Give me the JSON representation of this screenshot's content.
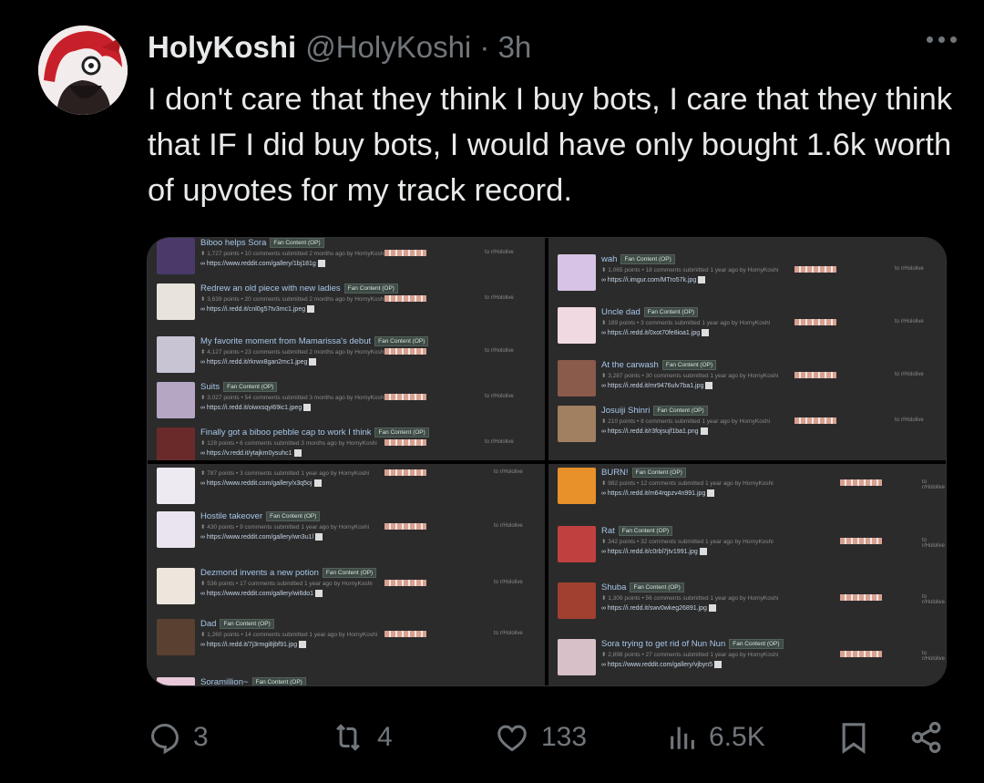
{
  "author": {
    "display_name": "HolyKoshi",
    "handle": "@HolyKoshi · 3h"
  },
  "tweet": {
    "text": "I don't care that they think I buy bots, I care that they think that IF I did buy bots, I would have only bought 1.6k worth of upvotes for my track record."
  },
  "media": {
    "flair": "Fan Content (OP)",
    "subreddit": "to r/Hololive",
    "panels": [
      {
        "entries": [
          {
            "title": "Biboo helps Sora",
            "meta": "1,727 points • 10 comments submitted 2 months ago by HornyKoshi",
            "url": "https://www.reddit.com/gallery/1bj181g",
            "thumb": "#4a3a6a"
          },
          {
            "title": "Redrew an old piece with new ladies",
            "meta": "3,639 points • 20 comments submitted 2 months ago by HornyKoshi",
            "url": "https://i.redd.it/cnl0g57tv3mc1.jpeg",
            "thumb": "#e8e4dc"
          },
          {
            "title": "My favorite moment from Mamarissa's debut",
            "meta": "4,127 points • 23 comments submitted 2 months ago by HornyKoshi",
            "url": "https://i.redd.it/rkrwx8gan2mc1.jpeg",
            "thumb": "#c9c4d4"
          },
          {
            "title": "Suits",
            "meta": "3,027 points • 54 comments submitted 3 months ago by HornyKoshi",
            "url": "https://i.redd.it/oiwxsqyi69ic1.jpeg",
            "thumb": "#b5a7c4"
          },
          {
            "title": "Finally got a biboo pebble cap to work I think",
            "meta": "128 points • 6 comments submitted 3 months ago by HornyKoshi",
            "url": "https://v.redd.it/ytajkm0ysuhc1",
            "thumb": "#6a2a2a"
          }
        ]
      },
      {
        "entries": [
          {
            "title": "wah",
            "meta": "1,065 points • 18 comments submitted 1 year ago by HornyKoshi",
            "url": "https://i.imgur.com/MTro57k.jpg",
            "thumb": "#d7c3e3"
          },
          {
            "title": "Uncle dad",
            "meta": "189 points • 3 comments submitted 1 year ago by HornyKoshi",
            "url": "https://i.redd.it/0xot70fe8ioa1.jpg",
            "thumb": "#f0d9e0"
          },
          {
            "title": "At the carwash",
            "meta": "3,287 points • 30 comments submitted 1 year ago by HornyKoshi",
            "url": "https://i.redd.it/mr9476ulv7ba1.jpg",
            "thumb": "#8a5a4a"
          },
          {
            "title": "Josuiji Shinri",
            "meta": "210 points • 8 comments submitted 1 year ago by HornyKoshi",
            "url": "https://i.redd.it/r3fojsujf1ba1.png",
            "thumb": "#a08060"
          }
        ]
      },
      {
        "entries": [
          {
            "title": "",
            "meta": "787 points • 3 comments submitted 1 year ago by HornyKoshi",
            "url": "https://www.reddit.com/gallery/x3q5oj",
            "thumb": "#eeeaf2"
          },
          {
            "title": "Hostile takeover",
            "meta": "430 points • 9 comments submitted 1 year ago by HornyKoshi",
            "url": "https://www.reddit.com/gallery/wn3u1l",
            "thumb": "#e9e4ee"
          },
          {
            "title": "Dezmond invents a new potion",
            "meta": "536 points • 17 comments submitted 1 year ago by HornyKoshi",
            "url": "https://www.reddit.com/gallery/wi6do1",
            "thumb": "#ece6dc"
          },
          {
            "title": "Dad",
            "meta": "1,260 points • 14 comments submitted 1 year ago by HornyKoshi",
            "url": "https://i.redd.it/7j3rmgi8jbf91.jpg",
            "thumb": "#5a4030"
          },
          {
            "title": "Soramillion~",
            "meta": "",
            "url": "",
            "thumb": "#e8c8d8"
          }
        ]
      },
      {
        "entries": [
          {
            "title": "BURN!",
            "meta": "982 points • 12 comments submitted 1 year ago by HornyKoshi",
            "url": "https://i.redd.it/m64rqpzv4n991.jpg",
            "thumb": "#e8902a"
          },
          {
            "title": "Rat",
            "meta": "342 points • 32 comments submitted 1 year ago by HornyKoshi",
            "url": "https://i.redd.it/c0rbl7jtv1991.jpg",
            "thumb": "#c04040"
          },
          {
            "title": "Shuba",
            "meta": "1,309 points • 56 comments submitted 1 year ago by HornyKoshi",
            "url": "https://i.redd.it/swv0wkeg26891.jpg",
            "thumb": "#a04030"
          },
          {
            "title": "Sora trying to get rid of Nun Nun",
            "meta": "2,898 points • 27 comments submitted 1 year ago by HornyKoshi",
            "url": "https://www.reddit.com/gallery/vjbyn5",
            "thumb": "#d8c0c8"
          }
        ]
      }
    ]
  },
  "actions": {
    "replies": "3",
    "reposts": "4",
    "likes": "133",
    "views": "6.5K"
  },
  "icons": [
    "more-icon",
    "reply-icon",
    "repost-icon",
    "like-icon",
    "views-icon",
    "bookmark-icon",
    "share-icon"
  ],
  "colors": {
    "background": "#000000",
    "text": "#e7e9ea",
    "secondary": "#71767b",
    "panel": "#2b2b2c"
  }
}
